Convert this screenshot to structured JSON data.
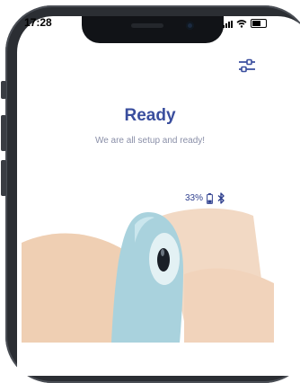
{
  "status_bar": {
    "time": "17:28"
  },
  "header": {
    "settings_icon": "sliders-icon"
  },
  "main": {
    "title": "Ready",
    "subtitle": "We are all setup and ready!"
  },
  "device": {
    "battery_percent": "33%",
    "battery_level": 0.33,
    "bluetooth_icon": "bluetooth-icon"
  },
  "colors": {
    "accent": "#3a4e9e",
    "skin": "#efcfb3",
    "device": "#a9d2dd"
  }
}
